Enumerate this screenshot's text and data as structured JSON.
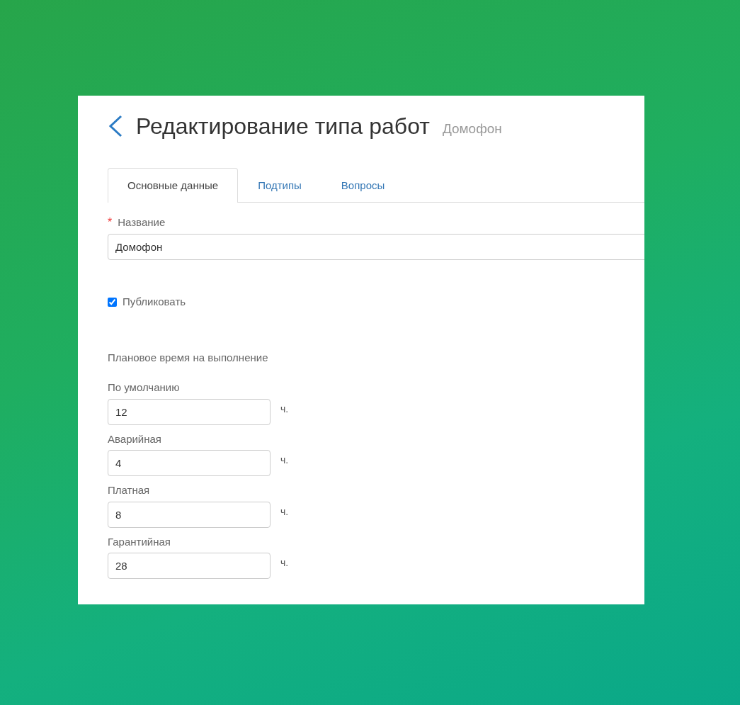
{
  "header": {
    "title": "Редактирование типа работ",
    "subtitle": "Домофон"
  },
  "tabs": [
    {
      "label": "Основные данные",
      "selected": true
    },
    {
      "label": "Подтипы",
      "selected": false
    },
    {
      "label": "Вопросы",
      "selected": false
    }
  ],
  "name_field": {
    "label": "Название",
    "required_mark": "*",
    "value": "Домофон"
  },
  "publish": {
    "label": "Публиковать",
    "checked": true
  },
  "planned_time": {
    "heading": "Плановое время на выполнение",
    "fields": [
      {
        "label": "По умолчанию",
        "value": "12",
        "unit": "ч."
      },
      {
        "label": "Аварийная",
        "value": "4",
        "unit": "ч."
      },
      {
        "label": "Платная",
        "value": "8",
        "unit": "ч."
      },
      {
        "label": "Гарантийная",
        "value": "28",
        "unit": "ч."
      }
    ]
  }
}
